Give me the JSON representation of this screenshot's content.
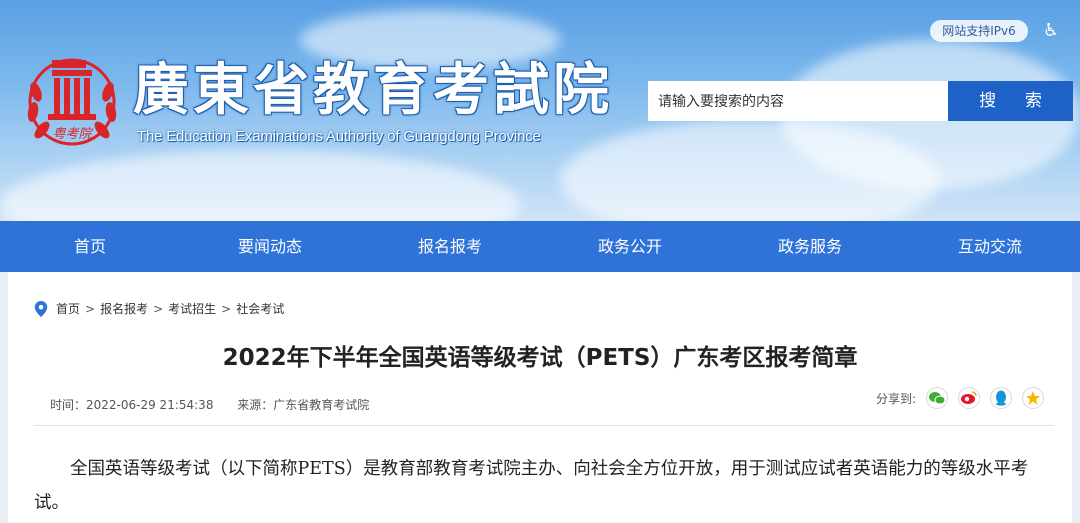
{
  "header": {
    "title": "廣東省教育考試院",
    "subtitle": "The Education Examinations Authority of Guangdong Province",
    "ipv6_badge": "网站支持IPv6",
    "accessibility_icon": "wheelchair-icon",
    "logo_text": "粤考院"
  },
  "search": {
    "placeholder": "请输入要搜索的内容",
    "button_label": "搜 索"
  },
  "nav": {
    "items": [
      {
        "label": "首页"
      },
      {
        "label": "要闻动态"
      },
      {
        "label": "报名报考"
      },
      {
        "label": "政务公开"
      },
      {
        "label": "政务服务"
      },
      {
        "label": "互动交流"
      }
    ]
  },
  "breadcrumb": {
    "items": [
      "首页",
      "报名报考",
      "考试招生",
      "社会考试"
    ],
    "separator": ">"
  },
  "article": {
    "title": "2022年下半年全国英语等级考试（PETS）广东考区报考简章",
    "time": "时间：2022-06-29 21:54:38",
    "source": "来源：广东省教育考试院",
    "share_label": "分享到:",
    "share_targets": [
      "wechat-icon",
      "weibo-icon",
      "qq-icon",
      "qzone-icon"
    ],
    "body": "全国英语等级考试（以下简称PETS）是教育部教育考试院主办、向社会全方位开放，用于测试应试者英语能力的等级水平考试。"
  },
  "colors": {
    "nav_bg": "#2f73d8",
    "search_button": "#1f62c7",
    "logo_red": "#d8252a"
  }
}
